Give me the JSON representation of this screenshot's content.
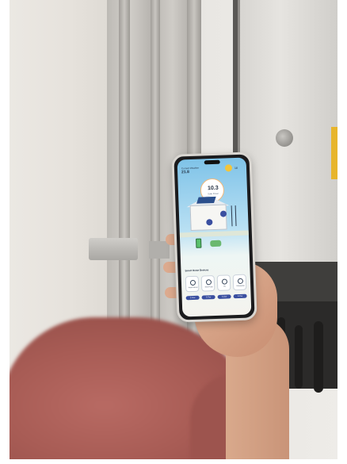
{
  "phone_app": {
    "location": "Current Weather",
    "temperature": "21.8",
    "weather_temp": "18",
    "power_value": "10.3",
    "power_unit": "kW",
    "power_label": "Solar Power",
    "section_title": "Smart Home Devices",
    "devices": [
      {
        "label": "Water Heater",
        "value": "2.1kw",
        "icon": "water-heater-icon"
      },
      {
        "label": "Heat Pump",
        "value": "0.7kw",
        "icon": "heat-pump-icon"
      },
      {
        "label": "EV",
        "value": "3.1kw",
        "icon": "ev-charger-icon"
      },
      {
        "label": "Dishwasher",
        "value": "0.7kw",
        "icon": "dishwasher-icon"
      }
    ]
  },
  "colors": {
    "sky": "#7fc3e8",
    "sun": "#f3c53a",
    "accent": "#3a4fa0",
    "battery": "#59c06b",
    "shirt": "#a85c55",
    "inverter_label": "#e7b52c"
  }
}
